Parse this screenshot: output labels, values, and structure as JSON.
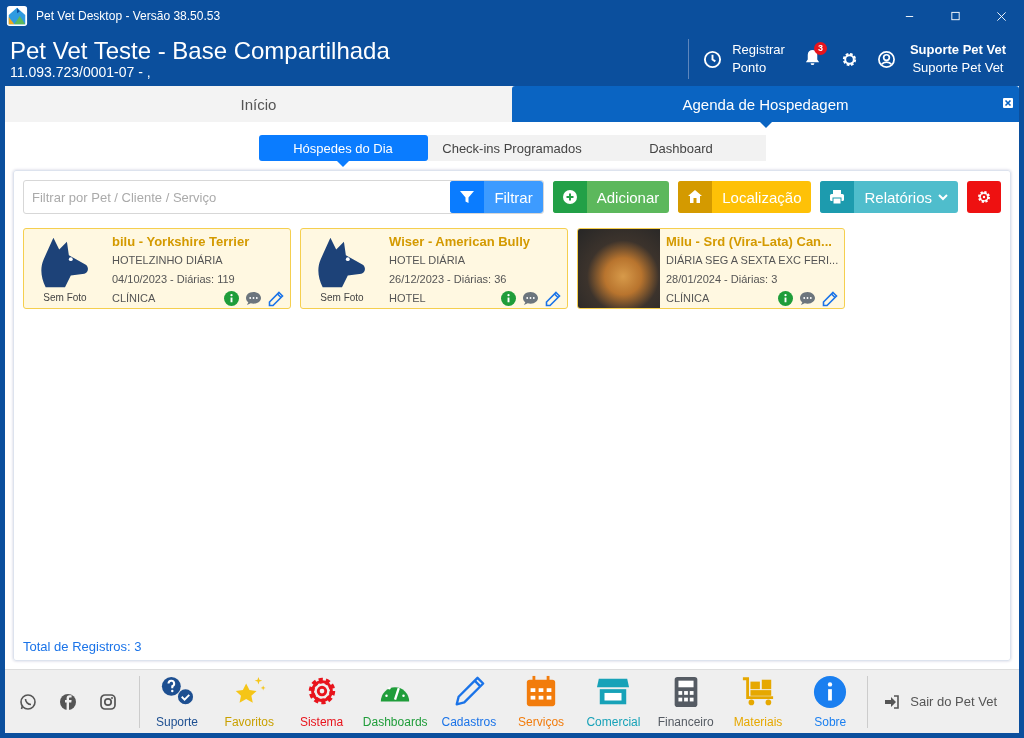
{
  "window": {
    "title": "Pet Vet Desktop - Versão 38.50.53"
  },
  "header": {
    "company": "Pet Vet Teste - Base Compartilhada",
    "subtitle": "11.093.723/0001-07 -  ,",
    "register_lines": [
      "Registrar",
      "Ponto"
    ],
    "notification_count": "3",
    "user_name": "Suporte Pet Vet",
    "user_role": "Suporte Pet Vet"
  },
  "tabs": [
    {
      "label": "Início",
      "selected": false
    },
    {
      "label": "Agenda de Hospedagem",
      "selected": true
    }
  ],
  "subtabs": [
    {
      "label": "Hóspedes do Dia",
      "selected": true
    },
    {
      "label": "Check-ins Programados",
      "selected": false
    },
    {
      "label": "Dashboard",
      "selected": false
    }
  ],
  "filter": {
    "placeholder": "Filtrar por Pet / Cliente / Serviço"
  },
  "buttons": [
    {
      "kind": "filter",
      "label": "Filtrar"
    },
    {
      "kind": "add",
      "label": "Adicionar"
    },
    {
      "kind": "location",
      "label": "Localização"
    },
    {
      "kind": "reports",
      "label": "Relatórios"
    },
    {
      "kind": "settings"
    }
  ],
  "guests": [
    {
      "name": "bilu - Yorkshire Terrier",
      "service": "HOTELZINHO DIÁRIA",
      "dates": "04/10/2023 - Diárias: 119",
      "category": "CLÍNICA",
      "has_photo": false,
      "photo_caption": "Sem Foto"
    },
    {
      "name": "Wiser  - American Bully",
      "service": "HOTEL DIÁRIA",
      "dates": "26/12/2023 - Diárias: 36",
      "category": "HOTEL",
      "has_photo": false,
      "photo_caption": "Sem Foto"
    },
    {
      "name": "Milu - Srd (Vira-Lata) Can...",
      "service": "DIÁRIA SEG A SEXTA EXC FERI...",
      "dates": "28/01/2024 - Diárias: 3",
      "category": "CLÍNICA",
      "has_photo": true
    }
  ],
  "total": "Total de Registros: 3",
  "nav": [
    {
      "kind": "support",
      "label": "Suporte",
      "color": "#1d4f91"
    },
    {
      "kind": "favorites",
      "label": "Favoritos",
      "color": "#f5c518"
    },
    {
      "kind": "system",
      "label": "Sistema",
      "color": "#e8141c"
    },
    {
      "kind": "dashboards",
      "label": "Dashboards",
      "color": "#1f9d3a"
    },
    {
      "kind": "records",
      "label": "Cadastros",
      "color": "#1a73e8"
    },
    {
      "kind": "services",
      "label": "Serviços",
      "color": "#f27c0c"
    },
    {
      "kind": "commercial",
      "label": "Comercial",
      "color": "#17a2b8"
    },
    {
      "kind": "finance",
      "label": "Financeiro",
      "color": "#555b63"
    },
    {
      "kind": "materials",
      "label": "Materiais",
      "color": "#e6a800"
    },
    {
      "kind": "about",
      "label": "Sobre",
      "color": "#1a7ff0"
    }
  ],
  "logout": "Sair do Pet Vet"
}
